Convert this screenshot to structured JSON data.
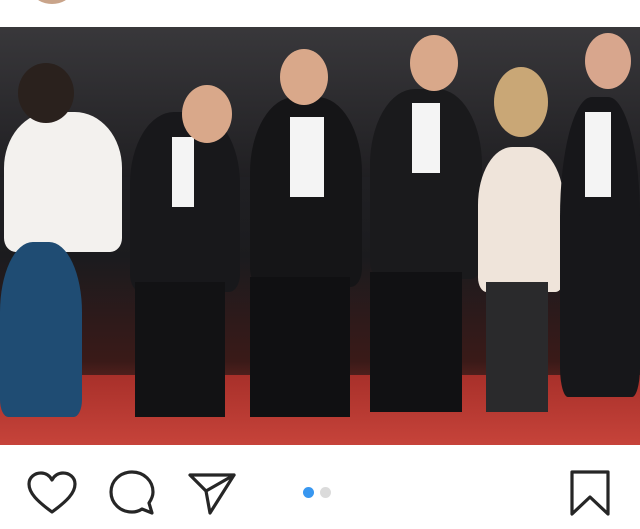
{
  "post": {
    "image_alt": "",
    "carousel": {
      "current": 1,
      "total": 2
    }
  },
  "actions": {
    "like": "heart-icon",
    "comment": "comment-bubble-icon",
    "share": "paper-plane-icon",
    "save": "bookmark-icon"
  },
  "colors": {
    "dot_active": "#3897f0",
    "dot_inactive": "#dbdbdb",
    "icon_stroke": "#262626",
    "carpet": "#b8372f"
  }
}
